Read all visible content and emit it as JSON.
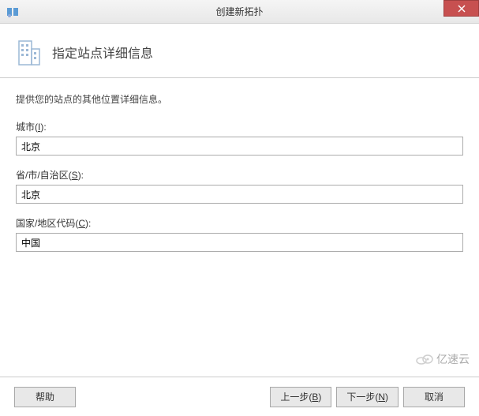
{
  "titlebar": {
    "title": "创建新拓扑"
  },
  "header": {
    "title": "指定站点详细信息"
  },
  "content": {
    "instruction": "提供您的站点的其他位置详细信息。",
    "fields": {
      "city": {
        "label_prefix": "城市(",
        "label_key": "I",
        "label_suffix": "):",
        "value": "北京"
      },
      "state": {
        "label_prefix": "省/市/自治区(",
        "label_key": "S",
        "label_suffix": "):",
        "value": "北京"
      },
      "country": {
        "label_prefix": "国家/地区代码(",
        "label_key": "C",
        "label_suffix": "):",
        "value": "中国"
      }
    }
  },
  "footer": {
    "help": "帮助",
    "back_prefix": "上一步(",
    "back_key": "B",
    "back_suffix": ")",
    "next_prefix": "下一步(",
    "next_key": "N",
    "next_suffix": ")",
    "cancel": "取消"
  },
  "watermark": "亿速云"
}
